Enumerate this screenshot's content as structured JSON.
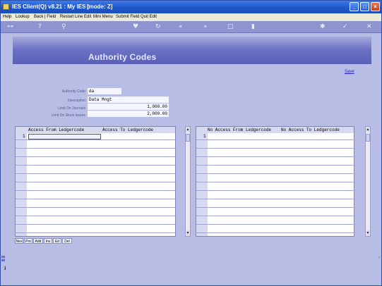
{
  "window": {
    "title": "IES Client(Q) v8.21 : My IES :",
    "mode": "[mode: Z]",
    "controls": {
      "minimize": "_",
      "maximize": "□",
      "close": "×"
    }
  },
  "menu": {
    "items": [
      "Help",
      "Lookup",
      "Back | Field",
      "Restart Line Edit",
      "Mini Menu",
      "Submit Field",
      "Quit Edit"
    ]
  },
  "toolbar": {
    "icons": [
      "key-icon",
      "help-icon",
      "search-icon",
      "heart-icon",
      "refresh-icon",
      "rewind-icon",
      "fast-forward-icon",
      "stop-icon",
      "trash-icon",
      "gear-icon",
      "check-icon",
      "close-icon"
    ],
    "glyphs": [
      "⊶",
      "?",
      "⚲",
      "♥",
      "↻",
      "«",
      "»",
      "□",
      "▮",
      "✱",
      "✓",
      "✕"
    ]
  },
  "banner": {
    "title": "Authority Codes"
  },
  "actions": {
    "save": "Save"
  },
  "form": {
    "authority_code": {
      "label": "Authority Code",
      "value": "da"
    },
    "description": {
      "label": "Description",
      "value": "Data Mngt"
    },
    "limit_on_journals": {
      "label": "Limit On Journals",
      "value": "1,000.00"
    },
    "limit_on_stock_issues": {
      "label": "Limit On Stock Issues",
      "value": "2,000.00"
    }
  },
  "grid_left": {
    "columns": [
      "Access From Ledgercode",
      "Access  To  Ledgercode"
    ],
    "rows": [
      {
        "num": "1",
        "from": "",
        "to": ""
      }
    ]
  },
  "grid_right": {
    "columns": [
      "No Access From Ledgercode",
      "No Access  To  Ledgercode"
    ],
    "rows": [
      {
        "num": "1",
        "from": "",
        "to": ""
      }
    ]
  },
  "grid_buttons": [
    "Nex",
    "Pre",
    "Add",
    "Ins",
    "Ed",
    "Del"
  ],
  "scroll": {
    "up": "▲",
    "down": "▼"
  },
  "side": {
    "left_marker": "ctx",
    "right_marker": "›"
  },
  "colors": {
    "background": "#b8bde6",
    "banner": "#6d73c4",
    "titlebar": "#1f57c9"
  }
}
